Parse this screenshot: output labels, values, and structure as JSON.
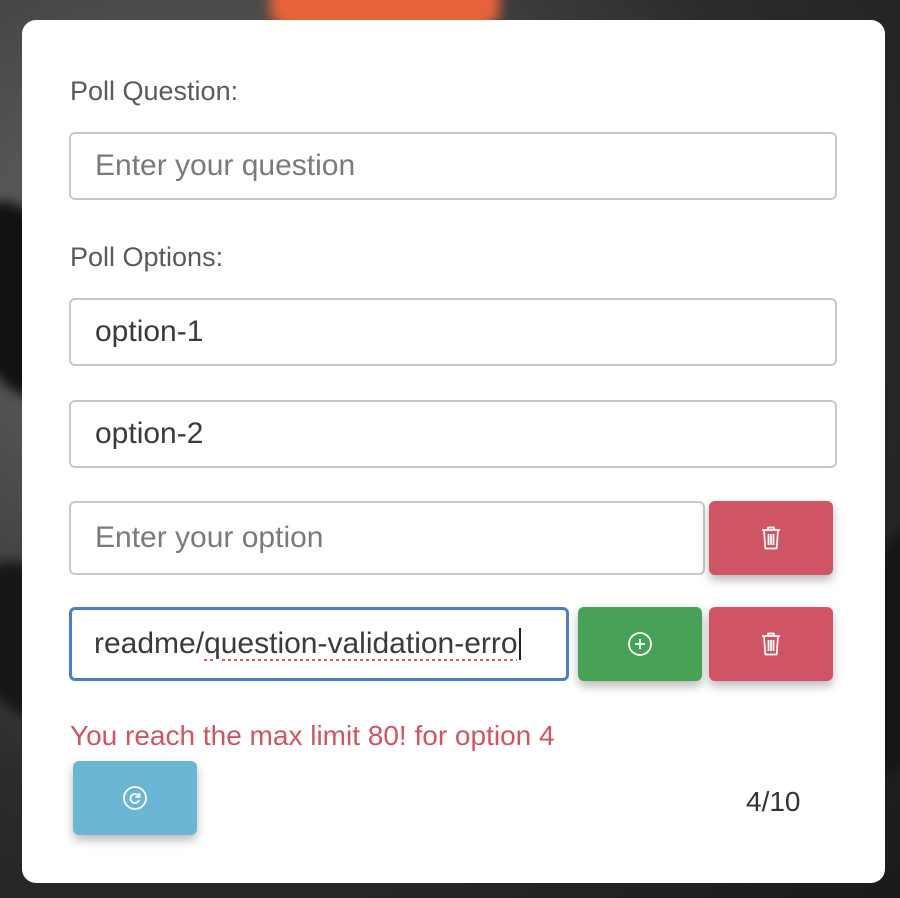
{
  "poll": {
    "question_label": "Poll Question:",
    "question_placeholder": "Enter your question",
    "question_value": "",
    "options_label": "Poll Options:",
    "options": [
      {
        "value": "option-1",
        "placeholder": "Enter your option"
      },
      {
        "value": "option-2",
        "placeholder": "Enter your option"
      },
      {
        "value": "",
        "placeholder": "Enter your option"
      },
      {
        "value": "readme/question-validation-erro",
        "placeholder": "Enter your option"
      }
    ],
    "error_message": "You reach the max limit 80! for option 4",
    "counter": "4/10"
  },
  "icons": {
    "delete": "trash-icon",
    "add": "plus-circle-icon",
    "reset": "refresh-icon"
  },
  "colors": {
    "delete_button": "#d05564",
    "add_button": "#47a257",
    "reset_button": "#6bb6d4",
    "error_text": "#d05564",
    "focus_border": "#4a7fc7"
  }
}
